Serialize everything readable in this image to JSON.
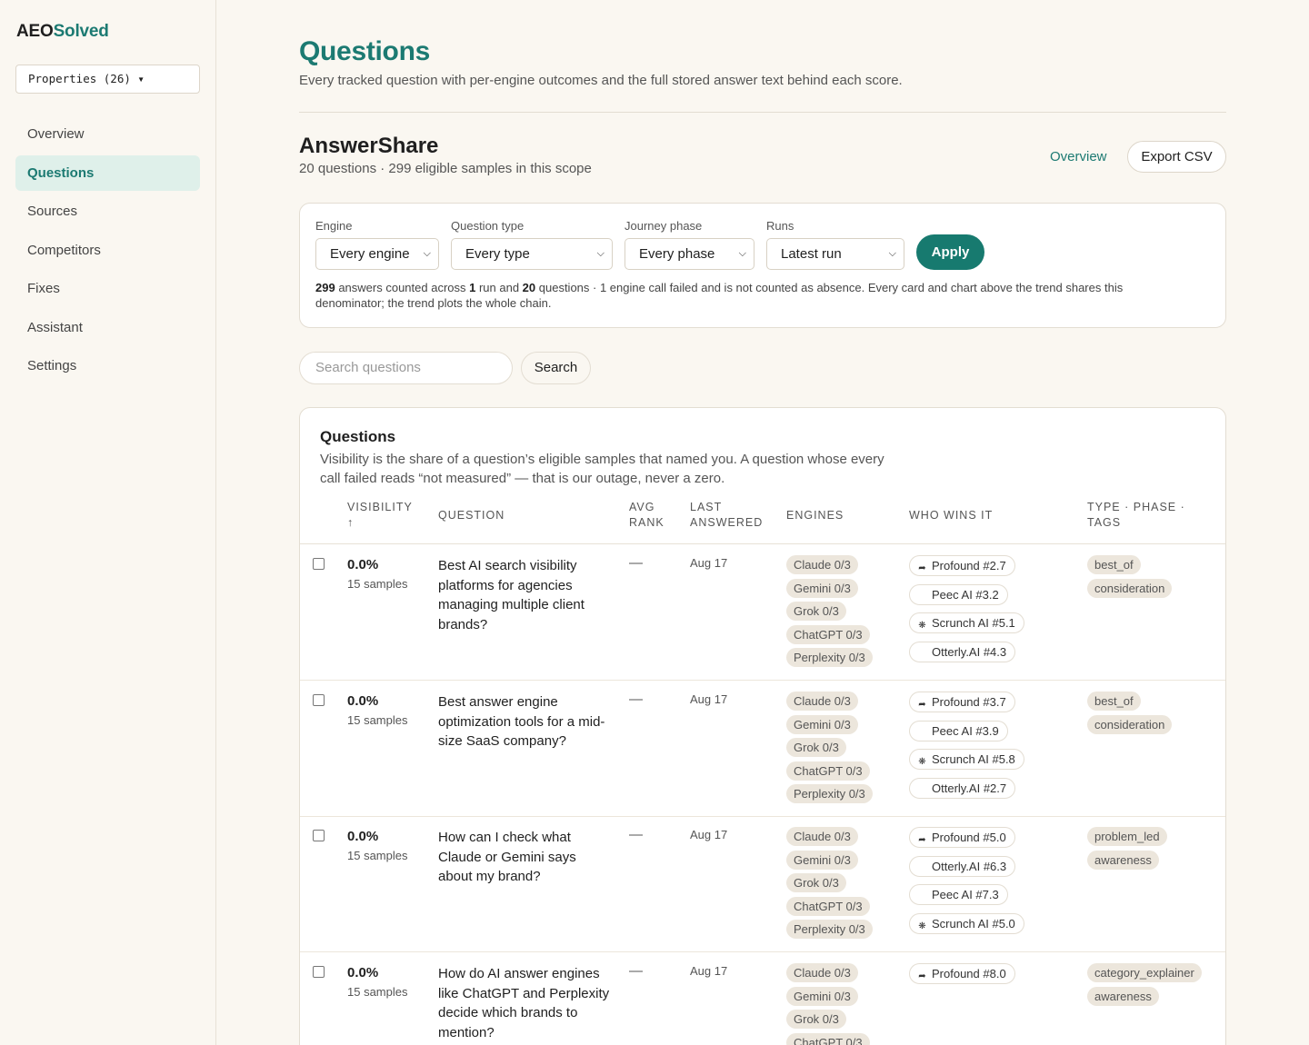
{
  "brand": {
    "part1": "AEO",
    "part2": "Solved"
  },
  "property_selector": {
    "label": "Properties (26) ▾"
  },
  "nav": [
    {
      "label": "Overview",
      "active": false
    },
    {
      "label": "Questions",
      "active": true
    },
    {
      "label": "Sources",
      "active": false
    },
    {
      "label": "Competitors",
      "active": false
    },
    {
      "label": "Fixes",
      "active": false
    },
    {
      "label": "Assistant",
      "active": false
    },
    {
      "label": "Settings",
      "active": false
    }
  ],
  "page": {
    "title": "Questions",
    "subtitle": "Every tracked question with per-engine outcomes and the full stored answer text behind each score."
  },
  "scope": {
    "name": "AnswerShare",
    "summary": "20 questions · 299 eligible samples in this scope",
    "overview_link": "Overview",
    "export_button": "Export CSV"
  },
  "filters": {
    "engine": {
      "label": "Engine",
      "value": "Every engine"
    },
    "question_type": {
      "label": "Question type",
      "value": "Every type"
    },
    "journey_phase": {
      "label": "Journey phase",
      "value": "Every phase"
    },
    "runs": {
      "label": "Runs",
      "value": "Latest run"
    },
    "apply_button": "Apply",
    "note": {
      "answers": "299",
      "t1": " answers counted across ",
      "runs": "1",
      "t2": " run and ",
      "questions": "20",
      "t3": " questions · 1 engine call failed and is not counted as absence. Every card and chart above the trend shares this denominator; the trend plots the whole chain."
    }
  },
  "search": {
    "placeholder": "Search questions",
    "button": "Search"
  },
  "questions_table": {
    "title": "Questions",
    "description": "Visibility is the share of a question’s eligible samples that named you. A question whose every call failed reads “not measured” — that is our outage, never a zero.",
    "headers": {
      "visibility": "VISIBILITY",
      "visibility_sort": "↑",
      "question": "QUESTION",
      "avg_rank_1": "AVG",
      "avg_rank_2": "RANK",
      "last_answered_1": "LAST",
      "last_answered_2": "ANSWERED",
      "engines": "ENGINES",
      "who_wins": "WHO WINS IT",
      "type_1": "TYPE · PHASE ·",
      "type_2": "TAGS"
    },
    "rows": [
      {
        "visibility": "0.0%",
        "samples": "15 samples",
        "question": "Best AI search visibility platforms for agencies managing multiple client brands?",
        "avg_rank": "—",
        "last_answered": "Aug 17",
        "engines": [
          "Claude 0/3",
          "Gemini 0/3",
          "Grok 0/3",
          "ChatGPT 0/3",
          "Perplexity 0/3"
        ],
        "winners": [
          {
            "label": "Profound #2.7",
            "icon": "profound-icon"
          },
          {
            "label": "Peec AI #3.2",
            "icon": ""
          },
          {
            "label": "Scrunch AI #5.1",
            "icon": "scrunch-icon"
          },
          {
            "label": "Otterly.AI #4.3",
            "icon": ""
          }
        ],
        "tags": [
          "best_of",
          "consideration"
        ]
      },
      {
        "visibility": "0.0%",
        "samples": "15 samples",
        "question": "Best answer engine optimization tools for a mid-size SaaS company?",
        "avg_rank": "—",
        "last_answered": "Aug 17",
        "engines": [
          "Claude 0/3",
          "Gemini 0/3",
          "Grok 0/3",
          "ChatGPT 0/3",
          "Perplexity 0/3"
        ],
        "winners": [
          {
            "label": "Profound #3.7",
            "icon": "profound-icon"
          },
          {
            "label": "Peec AI #3.9",
            "icon": ""
          },
          {
            "label": "Scrunch AI #5.8",
            "icon": "scrunch-icon"
          },
          {
            "label": "Otterly.AI #2.7",
            "icon": ""
          }
        ],
        "tags": [
          "best_of",
          "consideration"
        ]
      },
      {
        "visibility": "0.0%",
        "samples": "15 samples",
        "question": "How can I check what Claude or Gemini says about my brand?",
        "avg_rank": "—",
        "last_answered": "Aug 17",
        "engines": [
          "Claude 0/3",
          "Gemini 0/3",
          "Grok 0/3",
          "ChatGPT 0/3",
          "Perplexity 0/3"
        ],
        "winners": [
          {
            "label": "Profound #5.0",
            "icon": "profound-icon"
          },
          {
            "label": "Otterly.AI #6.3",
            "icon": ""
          },
          {
            "label": "Peec AI #7.3",
            "icon": ""
          },
          {
            "label": "Scrunch AI #5.0",
            "icon": "scrunch-icon"
          }
        ],
        "tags": [
          "problem_led",
          "awareness"
        ]
      },
      {
        "visibility": "0.0%",
        "samples": "15 samples",
        "question": "How do AI answer engines like ChatGPT and Perplexity decide which brands to mention?",
        "avg_rank": "—",
        "last_answered": "Aug 17",
        "engines": [
          "Claude 0/3",
          "Gemini 0/3",
          "Grok 0/3",
          "ChatGPT 0/3"
        ],
        "winners": [
          {
            "label": "Profound #8.0",
            "icon": "profound-icon"
          }
        ],
        "tags": [
          "category_explainer",
          "awareness"
        ]
      }
    ]
  }
}
